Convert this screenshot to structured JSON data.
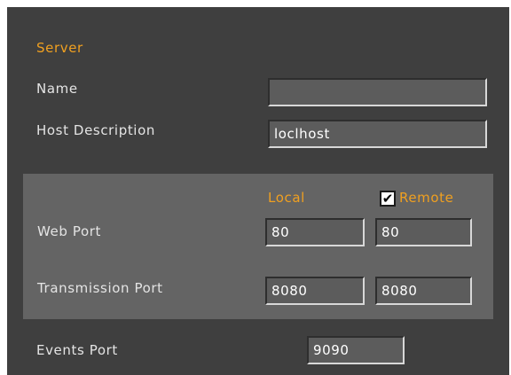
{
  "server": {
    "heading": "Server",
    "name_label": "Name",
    "name_value": "",
    "host_label": "Host Description",
    "host_value": "loclhost"
  },
  "ports": {
    "local_header": "Local",
    "remote_header": "Remote",
    "remote_checked": true,
    "checkmark": "✔",
    "web_label": "Web Port",
    "web_local": "80",
    "web_remote": "80",
    "transmission_label": "Transmission Port",
    "transmission_local": "8080",
    "transmission_remote": "8080"
  },
  "events": {
    "label": "Events Port",
    "value": "9090"
  },
  "colors": {
    "background": "#3f3f3f",
    "group_background": "#646464",
    "accent": "#f0a020",
    "text": "#e4e4e4"
  }
}
